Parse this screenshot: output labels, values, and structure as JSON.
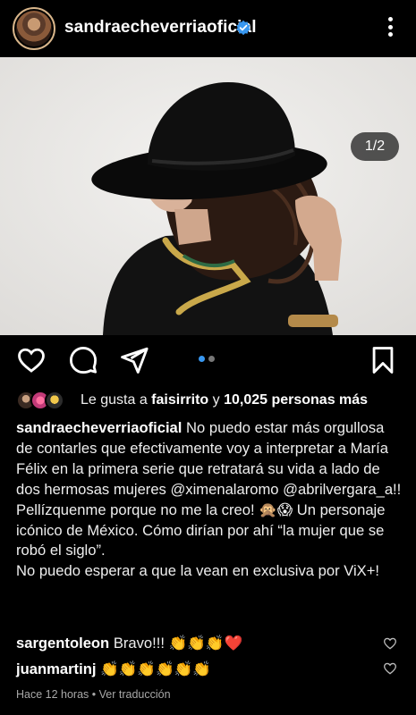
{
  "header": {
    "username": "sandraecheverriaoficial",
    "verified_icon": "verified-badge-icon",
    "more_icon": "more-options-icon"
  },
  "post": {
    "image_counter": "1/2",
    "carousel_total": 2,
    "carousel_active": 1
  },
  "actions": {
    "like_icon": "heart-icon",
    "comment_icon": "comment-icon",
    "share_icon": "send-icon",
    "save_icon": "bookmark-icon"
  },
  "likes": {
    "prefix": "Le gusta a ",
    "user": "faisirrito",
    "middle": " y ",
    "others": "10,025 personas más"
  },
  "caption": {
    "username": "sandraecheverriaoficial",
    "text": " No puedo estar más orgullosa de contarles que efectivamente voy a interpretar a María Félix en la primera serie que retratará su vida a lado de dos hermosas mujeres @ximenalaromo @abrilvergara_a!! Pellízquenme porque no me la creo! 🙊😱 Un personaje icónico de México. Cómo dirían por ahí “la mujer que se robó el siglo”.",
    "text2": "No puedo esperar a que la vean en exclusiva por ViX+!"
  },
  "comments": [
    {
      "username": "sargentoleon",
      "text": " Bravo!!! 👏👏👏❤️"
    },
    {
      "username": "juanmartinj",
      "text": " 👏👏👏👏👏👏"
    }
  ],
  "meta": {
    "time": "Hace 12 horas",
    "separator": " • ",
    "translate": "Ver traducción"
  },
  "colors": {
    "background": "#000000",
    "verified": "#3897f0",
    "carousel_active": "#3897f0",
    "heart_red": "#ff3040"
  }
}
